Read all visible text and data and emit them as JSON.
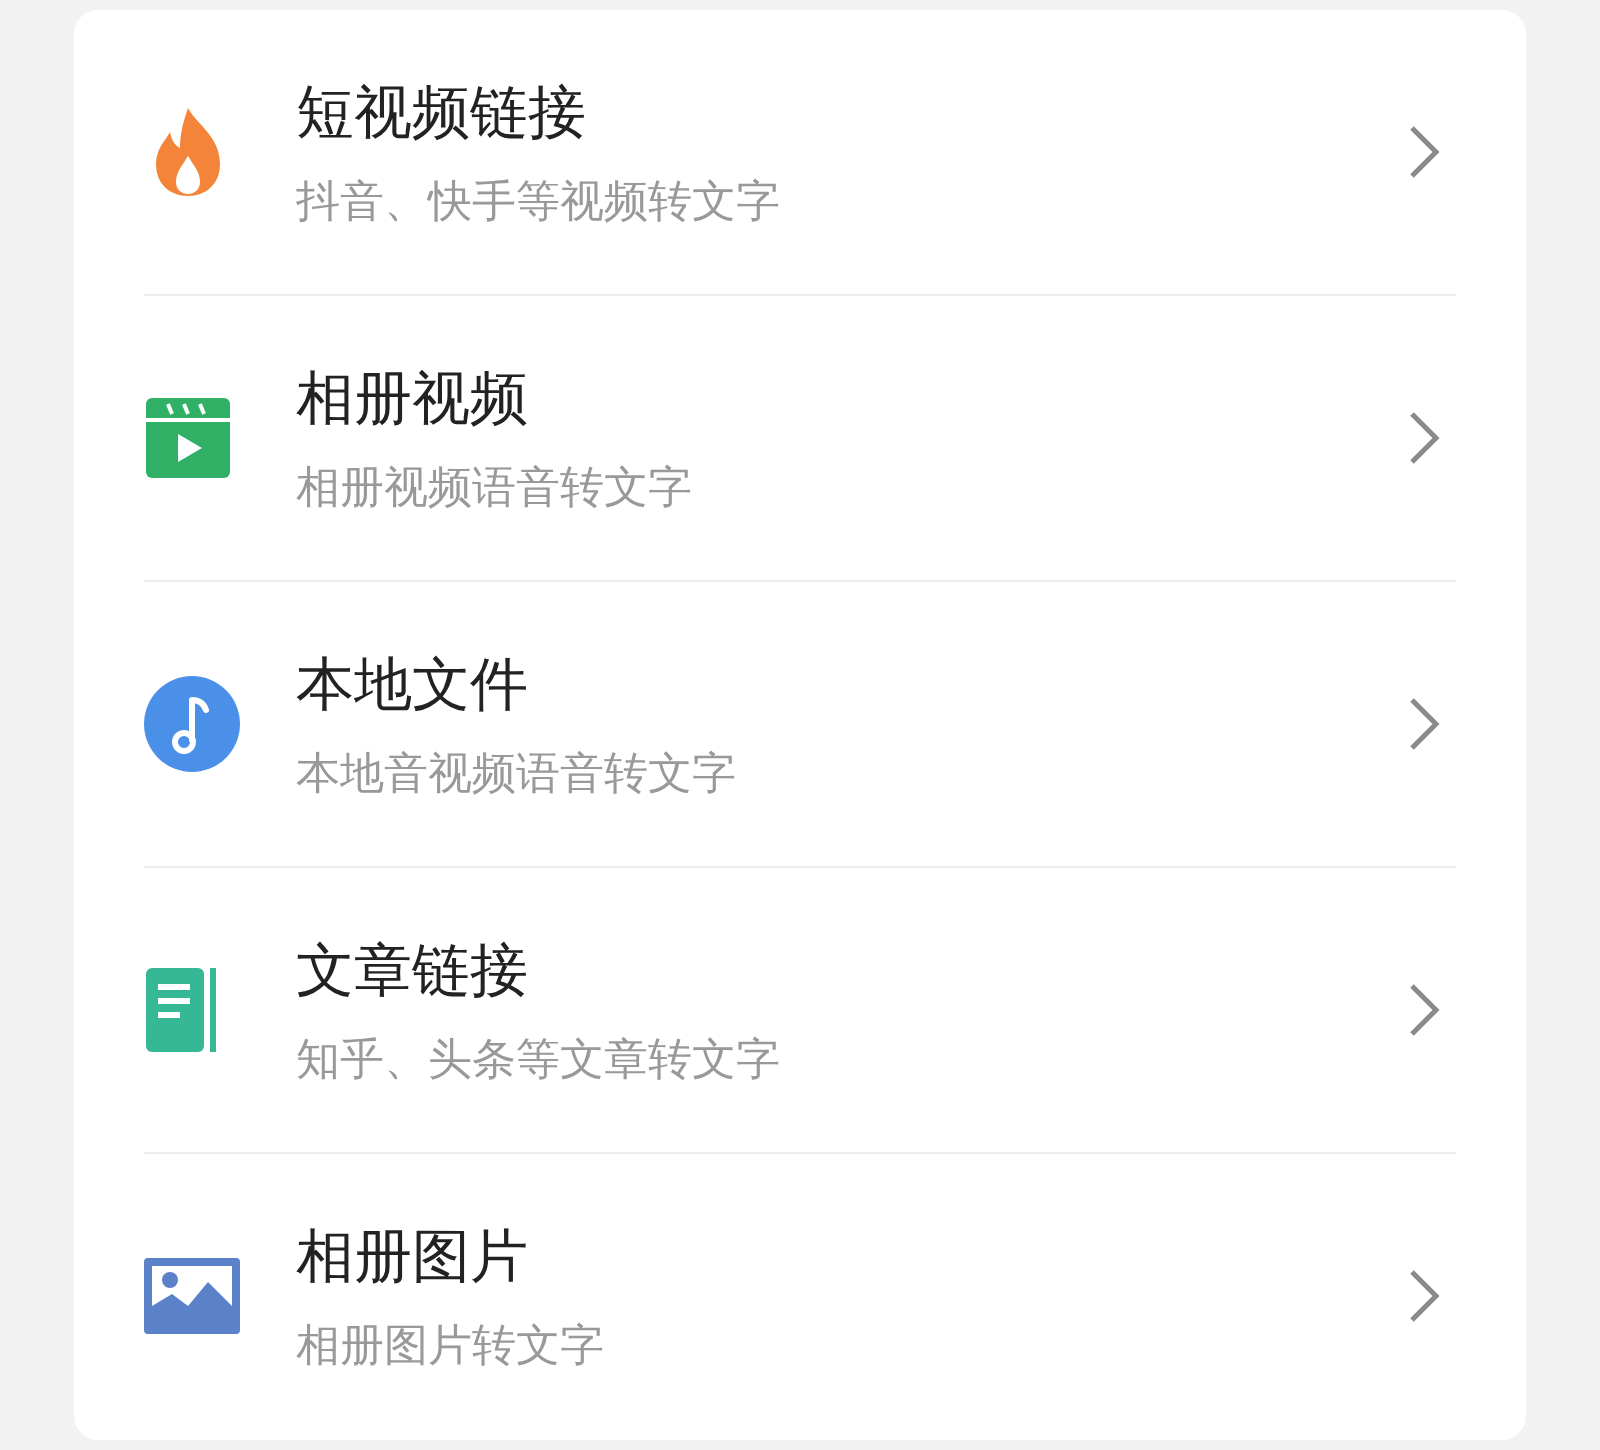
{
  "items": [
    {
      "kind": "flame",
      "title": "短视频链接",
      "subtitle": "抖音、快手等视频转文字"
    },
    {
      "kind": "video",
      "title": "相册视频",
      "subtitle": "相册视频语音转文字"
    },
    {
      "kind": "music",
      "title": "本地文件",
      "subtitle": "本地音视频语音转文字"
    },
    {
      "kind": "article",
      "title": "文章链接",
      "subtitle": "知乎、头条等文章转文字"
    },
    {
      "kind": "image",
      "title": "相册图片",
      "subtitle": "相册图片转文字"
    }
  ]
}
